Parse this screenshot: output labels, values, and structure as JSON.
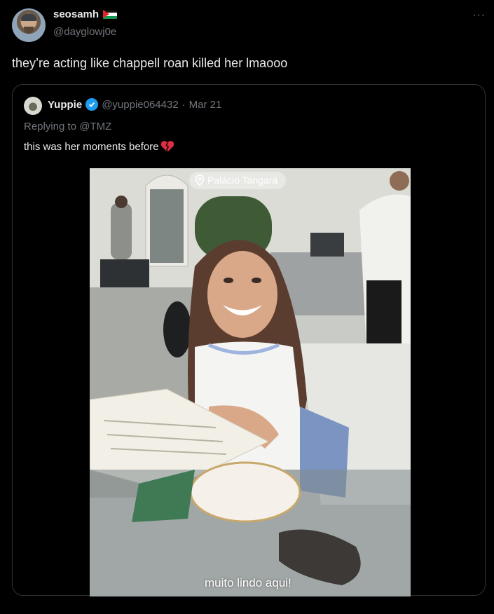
{
  "author": {
    "display_name": "seosamh",
    "handle": "@dayglowj0e",
    "flag_icon": "palestine-flag-icon"
  },
  "tweet": {
    "text": "they’re acting like chappell roan killed her lmaooo",
    "more_label": "···"
  },
  "quoted": {
    "display_name": "Yuppie",
    "handle": "@yuppie064432",
    "separator": "·",
    "date": "Mar 21",
    "reply_prefix": "Replying to ",
    "reply_to": "@TMZ",
    "text": "this was her moments before",
    "emoji_icon": "broken-heart-icon"
  },
  "media": {
    "location_label": "Palácio Tangará",
    "caption": "muito lindo aqui!"
  },
  "colors": {
    "background": "#000000",
    "text": "#e7e9ea",
    "muted": "#71767b",
    "border": "#2f3336",
    "verified": "#1d9bf0"
  }
}
